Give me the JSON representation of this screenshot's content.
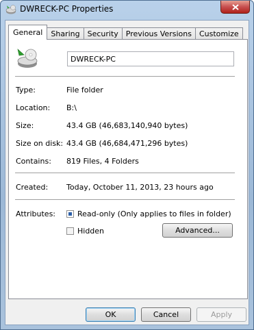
{
  "window": {
    "title": "DWRECK-PC Properties"
  },
  "tabs": [
    {
      "label": "General"
    },
    {
      "label": "Sharing"
    },
    {
      "label": "Security"
    },
    {
      "label": "Previous Versions"
    },
    {
      "label": "Customize"
    }
  ],
  "active_tab": "General",
  "general": {
    "name_value": "DWRECK-PC",
    "type_label": "Type:",
    "type_value": "File folder",
    "location_label": "Location:",
    "location_value": "B:\\",
    "size_label": "Size:",
    "size_value": "43.4 GB (46,683,140,940 bytes)",
    "size_on_disk_label": "Size on disk:",
    "size_on_disk_value": "43.4 GB (46,684,471,296 bytes)",
    "contains_label": "Contains:",
    "contains_value": "819 Files, 4 Folders",
    "created_label": "Created:",
    "created_value": "Today, October 11, 2013, 23 hours ago",
    "attributes_label": "Attributes:",
    "readonly_label": "Read-only (Only applies to files in folder)",
    "readonly_checked": true,
    "hidden_label": "Hidden",
    "hidden_checked": false,
    "advanced_button": "Advanced..."
  },
  "buttons": {
    "ok": "OK",
    "cancel": "Cancel",
    "apply": "Apply"
  },
  "icons": {
    "app": "folder-drive-icon",
    "close": "close-icon",
    "folder": "folder-drive-icon"
  }
}
